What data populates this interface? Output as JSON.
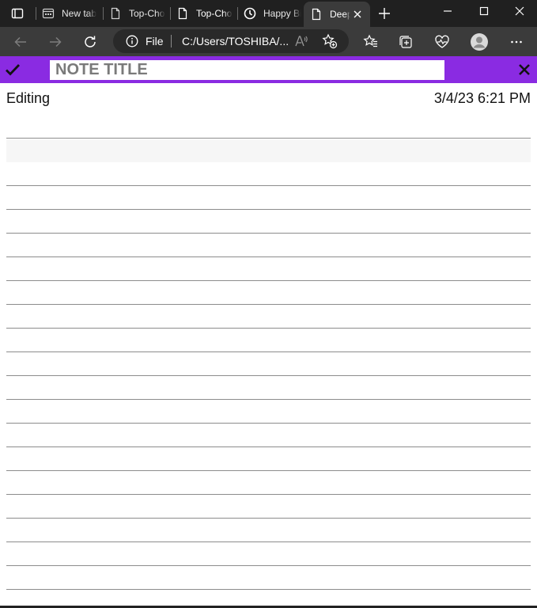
{
  "browser": {
    "tabs": [
      {
        "title": "New tab",
        "icon": "new-tab-page-icon",
        "active": false
      },
      {
        "title": "Top-Chores",
        "icon": "page-icon",
        "active": false
      },
      {
        "title": "Top-Chores",
        "icon": "page-icon",
        "active": false
      },
      {
        "title": "Happy Birthday",
        "icon": "clock-icon",
        "active": false
      },
      {
        "title": "Deep",
        "icon": "page-icon",
        "active": true
      }
    ],
    "address": {
      "scheme_label": "File",
      "url": "C:/Users/TOSHIBA/..."
    }
  },
  "app": {
    "header_color": "#8a2be2",
    "title_placeholder": "NOTE TITLE",
    "title_value": "",
    "status": "Editing",
    "timestamp": "3/4/23 6:21 PM",
    "body_value": ""
  }
}
